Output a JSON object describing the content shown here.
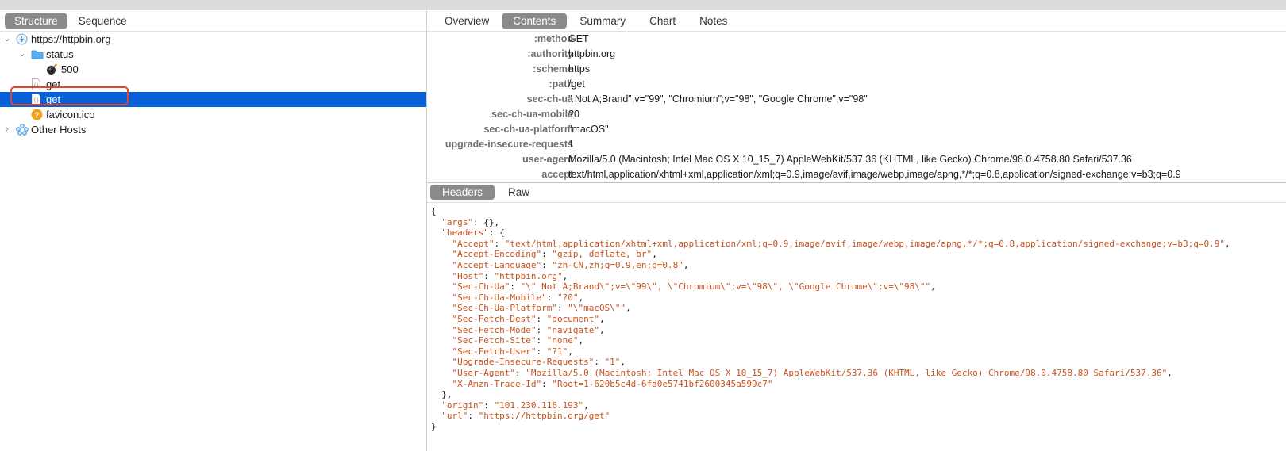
{
  "left": {
    "segments": [
      "Structure",
      "Sequence"
    ],
    "active_segment": "Structure",
    "tree": [
      {
        "label": "https://httpbin.org",
        "icon": "lightning-globe-icon",
        "expanded": true
      },
      {
        "label": "status",
        "icon": "folder-icon",
        "expanded": true
      },
      {
        "label": "500",
        "icon": "bomb-icon"
      },
      {
        "label": "get",
        "icon": "json-file-icon"
      },
      {
        "label": "get",
        "icon": "json-file-icon",
        "selected": true
      },
      {
        "label": "favicon.ico",
        "icon": "question-icon"
      },
      {
        "label": "Other Hosts",
        "icon": "cloud-network-icon",
        "expanded": false
      }
    ]
  },
  "right": {
    "tabs": [
      "Overview",
      "Contents",
      "Summary",
      "Chart",
      "Notes"
    ],
    "active_tab": "Contents",
    "headers": [
      {
        "key": ":method",
        "value": "GET"
      },
      {
        "key": ":authority",
        "value": "httpbin.org"
      },
      {
        "key": ":scheme",
        "value": "https"
      },
      {
        "key": ":path",
        "value": "/get"
      },
      {
        "key": "sec-ch-ua",
        "value": "\" Not A;Brand\";v=\"99\", \"Chromium\";v=\"98\", \"Google Chrome\";v=\"98\""
      },
      {
        "key": "sec-ch-ua-mobile",
        "value": "?0"
      },
      {
        "key": "sec-ch-ua-platform",
        "value": "\"macOS\""
      },
      {
        "key": "upgrade-insecure-requests",
        "value": "1"
      },
      {
        "key": "user-agent",
        "value": "Mozilla/5.0 (Macintosh; Intel Mac OS X 10_15_7) AppleWebKit/537.36 (KHTML, like Gecko) Chrome/98.0.4758.80 Safari/537.36"
      },
      {
        "key": "accept",
        "value": "text/html,application/xhtml+xml,application/xml;q=0.9,image/avif,image/webp,image/apng,*/*;q=0.8,application/signed-exchange;v=b3;q=0.9"
      }
    ],
    "subtabs": [
      "Headers",
      "Raw"
    ],
    "active_subtab": "Headers",
    "body_lines": [
      "{",
      "  \"args\": {},",
      "  \"headers\": {",
      "    \"Accept\": \"text/html,application/xhtml+xml,application/xml;q=0.9,image/avif,image/webp,image/apng,*/*;q=0.8,application/signed-exchange;v=b3;q=0.9\",",
      "    \"Accept-Encoding\": \"gzip, deflate, br\",",
      "    \"Accept-Language\": \"zh-CN,zh;q=0.9,en;q=0.8\",",
      "    \"Host\": \"httpbin.org\",",
      "    \"Sec-Ch-Ua\": \"\\\" Not A;Brand\\\";v=\\\"99\\\", \\\"Chromium\\\";v=\\\"98\\\", \\\"Google Chrome\\\";v=\\\"98\\\"\",",
      "    \"Sec-Ch-Ua-Mobile\": \"?0\",",
      "    \"Sec-Ch-Ua-Platform\": \"\\\"macOS\\\"\",",
      "    \"Sec-Fetch-Dest\": \"document\",",
      "    \"Sec-Fetch-Mode\": \"navigate\",",
      "    \"Sec-Fetch-Site\": \"none\",",
      "    \"Sec-Fetch-User\": \"?1\",",
      "    \"Upgrade-Insecure-Requests\": \"1\",",
      "    \"User-Agent\": \"Mozilla/5.0 (Macintosh; Intel Mac OS X 10_15_7) AppleWebKit/537.36 (KHTML, like Gecko) Chrome/98.0.4758.80 Safari/537.36\",",
      "    \"X-Amzn-Trace-Id\": \"Root=1-620b5c4d-6fd0e5741bf2600345a599c7\"",
      "  },",
      "  \"origin\": \"101.230.116.193\",",
      "  \"url\": \"https://httpbin.org/get\"",
      "}"
    ]
  },
  "colors": {
    "selection": "#0860d8",
    "segment_active": "#8a8a8a",
    "json_string": "#c8531d",
    "highlight_box": "#e2452a"
  }
}
